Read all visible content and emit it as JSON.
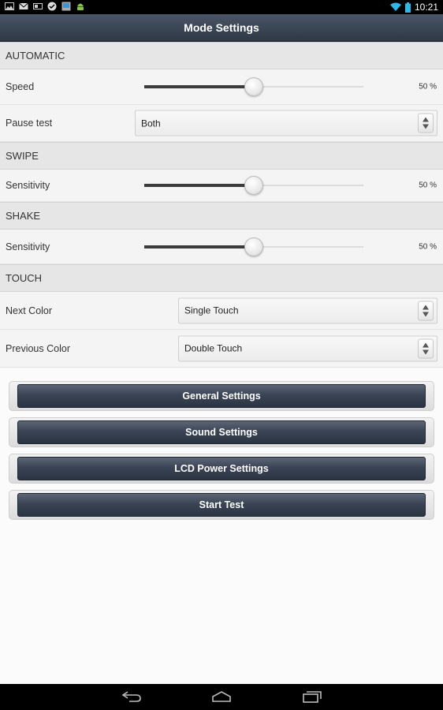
{
  "status_bar": {
    "time": "10:21",
    "left_icons": [
      "picture-icon",
      "gmail-icon",
      "news-icon",
      "check-icon",
      "screenshot-icon",
      "android-icon"
    ],
    "right_icons": [
      "wifi-icon",
      "battery-icon"
    ]
  },
  "app": {
    "title": "Mode Settings"
  },
  "sections": {
    "automatic": {
      "header": "AUTOMATIC",
      "speed": {
        "label": "Speed",
        "value_text": "50 %",
        "percent": 50
      },
      "pause_test": {
        "label": "Pause test",
        "selected": "Both"
      }
    },
    "swipe": {
      "header": "SWIPE",
      "sensitivity": {
        "label": "Sensitivity",
        "value_text": "50 %",
        "percent": 50
      }
    },
    "shake": {
      "header": "SHAKE",
      "sensitivity": {
        "label": "Sensitivity",
        "value_text": "50 %",
        "percent": 50
      }
    },
    "touch": {
      "header": "TOUCH",
      "next_color": {
        "label": "Next Color",
        "selected": "Single Touch"
      },
      "previous_color": {
        "label": "Previous Color",
        "selected": "Double Touch"
      }
    }
  },
  "buttons": {
    "general": "General Settings",
    "sound": "Sound Settings",
    "lcd": "LCD Power Settings",
    "start": "Start Test"
  },
  "colors": {
    "title_bar": "#3a4454",
    "button": "#3a4454",
    "section_bg": "#e6e6e6"
  }
}
